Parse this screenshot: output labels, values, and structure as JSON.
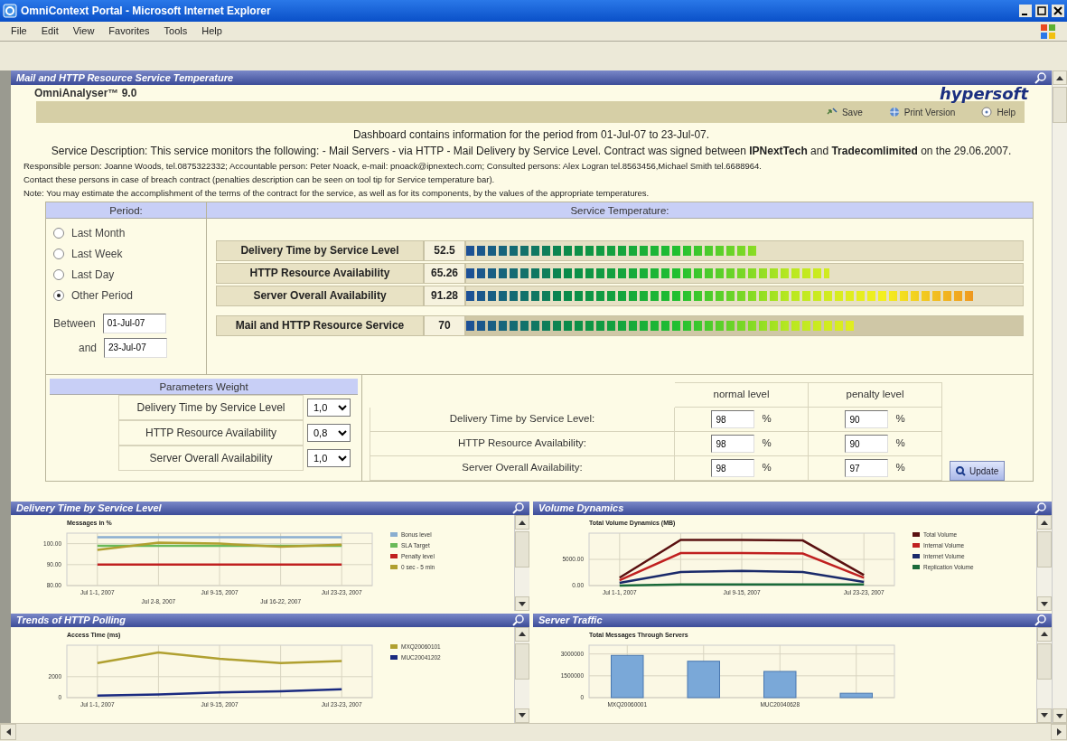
{
  "window": {
    "title": "OmniContext Portal - Microsoft Internet Explorer"
  },
  "menu": [
    "File",
    "Edit",
    "View",
    "Favorites",
    "Tools",
    "Help"
  ],
  "portlet": {
    "title": "Mail and HTTP Resource Service Temperature"
  },
  "product": "OmniAnalyser™ 9.0",
  "logo": "hypersoft",
  "toolbar": [
    {
      "kind": "save",
      "label": "Save"
    },
    {
      "kind": "print",
      "label": "Print Version"
    },
    {
      "kind": "help",
      "label": "Help"
    }
  ],
  "period_line": "Dashboard contains information for the period from 01-Jul-07 to 23-Jul-07.",
  "description": "Service Description: This service monitors the following: - Mail Servers - via HTTP - Mail Delivery by Service Level. Contract was signed between **IPNextTech** and **Tradecomlimited** on the 29.06.2007.",
  "notes": [
    "Responsible person: Joanne Woods, tel.0875322332; Accountable person: Peter Noack, e-mail: pnoack@ipnextech.com; Consulted persons: Alex Logran tel.8563456,Michael Smith tel.6688964.",
    "Contact these persons in case of breach contract (penalties description can be seen on tool tip for Service temperature bar).",
    "Note: You may estimate the accomplishment of the terms of the contract for the service, as well as for its components, by the values of the appropriate temperatures."
  ],
  "period": {
    "header": "Period:",
    "options": [
      {
        "label": "Last Month",
        "selected": false
      },
      {
        "label": "Last Week",
        "selected": false
      },
      {
        "label": "Last Day",
        "selected": false
      },
      {
        "label": "Other Period",
        "selected": true
      }
    ],
    "between_label": "Between",
    "from": "01-Jul-07",
    "and_label": "and",
    "to": "23-Jul-07"
  },
  "temperature": {
    "header": "Service Temperature:",
    "rows": [
      {
        "kind": "component",
        "name": "Delivery Time by Service Level",
        "value": "52.5",
        "level": 0.525
      },
      {
        "kind": "component",
        "name": "HTTP Resource Availability",
        "value": "65.26",
        "level": 0.6526
      },
      {
        "kind": "component",
        "name": "Server Overall Availability",
        "value": "91.28",
        "level": 0.9128
      },
      {
        "kind": "total",
        "name": "Mail and HTTP Resource Service",
        "value": "70",
        "level": 0.7
      }
    ]
  },
  "weights": {
    "header": "Parameters Weight",
    "rows": [
      {
        "name": "Delivery Time by Service Level",
        "value": "1,0"
      },
      {
        "name": "HTTP Resource Availability",
        "value": "0,8"
      },
      {
        "name": "Server Overall Availability",
        "value": "1,0"
      }
    ]
  },
  "levels": {
    "columns": [
      "normal level",
      "penalty level"
    ],
    "rows": [
      {
        "name": "Delivery Time by Service Level:",
        "normal": "98",
        "normal_unit": "%",
        "penalty": "90",
        "penalty_unit": "%"
      },
      {
        "name": "HTTP Resource Availability:",
        "normal": "98",
        "normal_unit": "%",
        "penalty": "90",
        "penalty_unit": "%"
      },
      {
        "name": "Server Overall Availability:",
        "normal": "98",
        "normal_unit": "%",
        "penalty": "97",
        "penalty_unit": "%"
      }
    ]
  },
  "update_button": "Update",
  "charts": [
    {
      "title": "Delivery Time by Service Level",
      "chart_data": {
        "type": "line",
        "title": "Messages in %",
        "grid": true,
        "legend": "right",
        "categories": [
          "Jul 1-1, 2007",
          "Jul 2-8, 2007",
          "Jul 9-15, 2007",
          "Jul 16-22, 2007",
          "Jul 23-23, 2007"
        ],
        "ylim": [
          80,
          105
        ],
        "yticks": [
          {
            "value": 80,
            "label": "80.00"
          },
          {
            "value": 90,
            "label": "90.00"
          },
          {
            "value": 100,
            "label": "100.00"
          }
        ],
        "series": [
          {
            "name": "Bonus level",
            "color": "#8aaed0",
            "values": [
              103,
              103,
              103,
              103,
              103
            ]
          },
          {
            "name": "SLA Target",
            "color": "#6aba5a",
            "values": [
              99,
              99,
              99,
              99,
              99
            ]
          },
          {
            "name": "Penalty level",
            "color": "#c02020",
            "values": [
              90,
              90,
              90,
              90,
              90
            ]
          },
          {
            "name": "0 sec - 5 min",
            "color": "#b0a030",
            "values": [
              97,
              100.5,
              100,
              98.5,
              99.5
            ]
          }
        ]
      }
    },
    {
      "title": "Volume Dynamics",
      "chart_data": {
        "type": "line",
        "title": "Total Volume Dynamics (MB)",
        "grid": true,
        "legend": "right",
        "categories": [
          "Jul 1-1, 2007",
          null,
          "Jul 9-15, 2007",
          null,
          "Jul 23-23, 2007"
        ],
        "ylim": [
          0,
          10000
        ],
        "yticks": [
          {
            "value": 0,
            "label": "0.00"
          },
          {
            "value": 5000,
            "label": "5000.00"
          }
        ],
        "series": [
          {
            "name": "Total Volume",
            "color": "#5a1010",
            "values": [
              1500,
              8700,
              8700,
              8600,
              2000
            ]
          },
          {
            "name": "Internal Volume",
            "color": "#c02020",
            "values": [
              1000,
              6200,
              6200,
              6100,
              1500
            ]
          },
          {
            "name": "Internet Volume",
            "color": "#1a2a6a",
            "values": [
              500,
              2600,
              2800,
              2600,
              700
            ]
          },
          {
            "name": "Replication Volume",
            "color": "#1a6a3a",
            "values": [
              0,
              200,
              200,
              200,
              200
            ]
          }
        ]
      }
    },
    {
      "title": "Trends of HTTP Polling",
      "chart_data": {
        "type": "line",
        "title": "Access Time (ms)",
        "grid": true,
        "legend": "right",
        "categories": [
          "Jul 1-1, 2007",
          null,
          "Jul 9-15, 2007",
          null,
          "Jul 23-23, 2007"
        ],
        "ylim": [
          0,
          5000
        ],
        "yticks": [
          {
            "value": 0,
            "label": "0"
          },
          {
            "value": 2000,
            "label": "2000"
          }
        ],
        "series": [
          {
            "name": "MXQ20060101",
            "color": "#b0a030",
            "values": [
              3300,
              4300,
              3700,
              3300,
              3500
            ]
          },
          {
            "name": "MUC20041202",
            "color": "#1a2a80",
            "values": [
              200,
              300,
              500,
              600,
              800
            ]
          }
        ]
      }
    },
    {
      "title": "Server Traffic",
      "chart_data": {
        "type": "bar",
        "title": "Total Messages Through Servers",
        "grid": true,
        "categories": [
          "MXQ20060001",
          null,
          "MUC20040628",
          null
        ],
        "ylim": [
          0,
          3600000
        ],
        "yticks": [
          {
            "value": 0,
            "label": "0"
          },
          {
            "value": 1500000,
            "label": "1500000"
          },
          {
            "value": 3000000,
            "label": "3000000"
          }
        ],
        "values": [
          2900000,
          2500000,
          1800000,
          300000
        ]
      }
    }
  ]
}
